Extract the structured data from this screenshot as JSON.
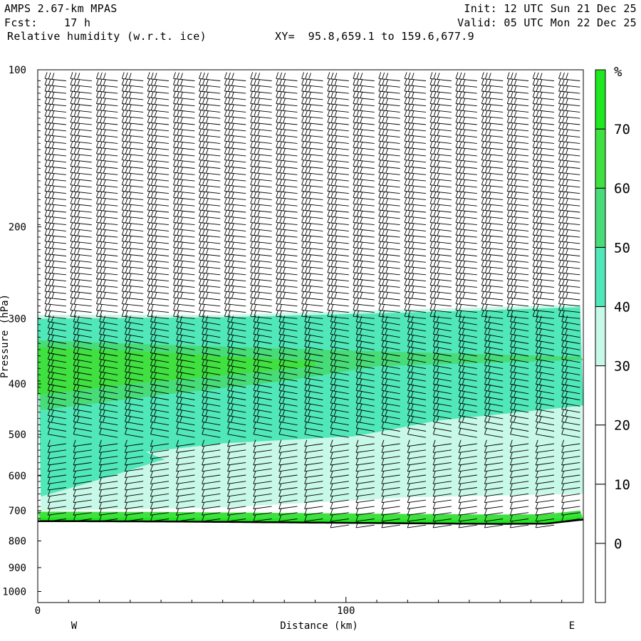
{
  "header": {
    "model": "AMPS 2.67-km MPAS",
    "forecast": "Fcst:    17 h",
    "field": "Relative humidity (w.r.t. ice)",
    "section": "XY=  95.8,659.1 to 159.6,677.9",
    "init": "Init: 12 UTC Sun 21 Dec 25",
    "valid": "Valid: 05 UTC Mon 22 Dec 25"
  },
  "chart_data": {
    "type": "heatmap",
    "title": "Relative humidity (w.r.t. ice)",
    "xlabel": "Distance (km)",
    "ylabel": "Pressure (hPa)",
    "x_range_km": [
      0,
      177
    ],
    "y_range_hpa": [
      1050,
      100
    ],
    "y_scale": "log",
    "x_ticks": [
      "0",
      "100"
    ],
    "y_ticks": [
      100,
      200,
      300,
      400,
      500,
      600,
      700,
      800,
      900,
      1000
    ],
    "y_tick_labels": [
      "100",
      "200",
      "300",
      "400",
      "500",
      "600",
      "700",
      "800",
      "900",
      "1000"
    ],
    "west_label": "W",
    "east_label": "E",
    "colorbar": {
      "unit": "%",
      "levels": [
        0,
        10,
        20,
        30,
        40,
        50,
        60,
        70
      ],
      "labels": [
        "0",
        "10",
        "20",
        "30",
        "40",
        "50",
        "60",
        "70"
      ],
      "colors": [
        "#ffffff",
        "#ffffff",
        "#ffffff",
        "#ffffff",
        "#c8f8e8",
        "#50e8b8",
        "#48dc78",
        "#40e040",
        "#20e820"
      ]
    },
    "terrain_surface_hpa": [
      {
        "x_km": 0,
        "p": 733
      },
      {
        "x_km": 40,
        "p": 734
      },
      {
        "x_km": 80,
        "p": 737
      },
      {
        "x_km": 120,
        "p": 740
      },
      {
        "x_km": 150,
        "p": 742
      },
      {
        "x_km": 165,
        "p": 741
      },
      {
        "x_km": 177,
        "p": 728
      }
    ],
    "rh_bands": [
      {
        "name": "rh-30-40",
        "level": 30,
        "upper": [
          [
            0,
            295
          ],
          [
            60,
            295
          ],
          [
            120,
            288
          ],
          [
            177,
            282
          ]
        ],
        "lower": [
          [
            0,
            700
          ],
          [
            60,
            690
          ],
          [
            120,
            660
          ],
          [
            177,
            650
          ]
        ]
      },
      {
        "name": "rh-40-50",
        "level": 40,
        "upper": [
          [
            0,
            300
          ],
          [
            60,
            298
          ],
          [
            120,
            292
          ],
          [
            177,
            285
          ]
        ],
        "lower": [
          [
            0,
            660
          ],
          [
            40,
            560
          ],
          [
            90,
            520
          ],
          [
            130,
            470
          ],
          [
            177,
            440
          ]
        ]
      },
      {
        "name": "rh-50-60",
        "level": 50,
        "upper": [
          [
            0,
            330
          ],
          [
            50,
            338
          ],
          [
            100,
            345
          ],
          [
            177,
            355
          ]
        ],
        "lower": [
          [
            0,
            450
          ],
          [
            40,
            420
          ],
          [
            80,
            395
          ],
          [
            110,
            370
          ],
          [
            177,
            360
          ]
        ]
      },
      {
        "name": "rh-60-70",
        "level": 60,
        "upper": [
          [
            0,
            340
          ],
          [
            40,
            348
          ],
          [
            75,
            358
          ],
          [
            90,
            362
          ]
        ],
        "lower": [
          [
            0,
            420
          ],
          [
            30,
            400
          ],
          [
            60,
            385
          ],
          [
            90,
            370
          ]
        ]
      }
    ],
    "dry_pocket": {
      "level": 30,
      "points": [
        [
          35,
          540
        ],
        [
          60,
          520
        ],
        [
          100,
          505
        ],
        [
          140,
          500
        ],
        [
          170,
          500
        ],
        [
          170,
          520
        ],
        [
          140,
          560
        ],
        [
          100,
          600
        ],
        [
          70,
          600
        ],
        [
          45,
          570
        ]
      ]
    },
    "moist_surface_layer": {
      "level": 60,
      "top_hpa_offset": 30
    },
    "wind_barbs": {
      "columns_km": [
        0,
        8.3,
        16.6,
        25,
        33.3,
        41.6,
        50,
        58.3,
        66.6,
        75,
        83.3,
        91.6,
        100,
        108.3,
        116.6,
        125,
        133.3,
        141.6,
        150,
        158.3,
        166.6,
        175
      ],
      "wind_from": "west-northwest"
    }
  }
}
